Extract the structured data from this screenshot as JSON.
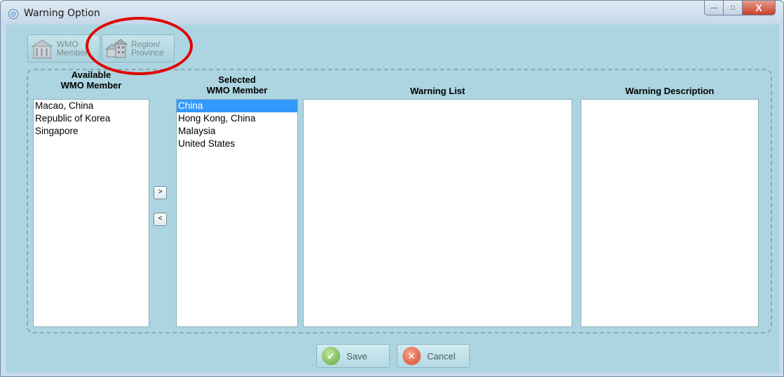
{
  "window": {
    "title": "Warning Option",
    "minimize_glyph": "—",
    "maximize_glyph": "□",
    "close_glyph": "X"
  },
  "toolbar": {
    "wmo_member": {
      "line1": "WMO",
      "line2": "Member",
      "icon": "building-icon"
    },
    "region_province": {
      "line1": "Region/",
      "line2": "Province",
      "icon": "houses-icon"
    }
  },
  "columns": {
    "available": {
      "line1": "Available",
      "line2": "WMO Member"
    },
    "selected": {
      "line1": "Selected",
      "line2": "WMO Member"
    },
    "warning_list": "Warning List",
    "warning_description": "Warning Description"
  },
  "available_members": [
    "Macao, China",
    "Republic of Korea",
    "Singapore"
  ],
  "selected_members": [
    "China",
    "Hong Kong, China",
    "Malaysia",
    "United States"
  ],
  "selected_index": 0,
  "move_buttons": {
    "add": ">",
    "remove": "<"
  },
  "actions": {
    "save": {
      "label": "Save",
      "icon": "check-icon",
      "icon_glyph": "✔"
    },
    "cancel": {
      "label": "Cancel",
      "icon": "x-circle-icon",
      "icon_glyph": "✕"
    }
  },
  "colors": {
    "client_bg": "#acd5e1",
    "selection": "#3399ff",
    "highlight_circle": "#e00000"
  }
}
